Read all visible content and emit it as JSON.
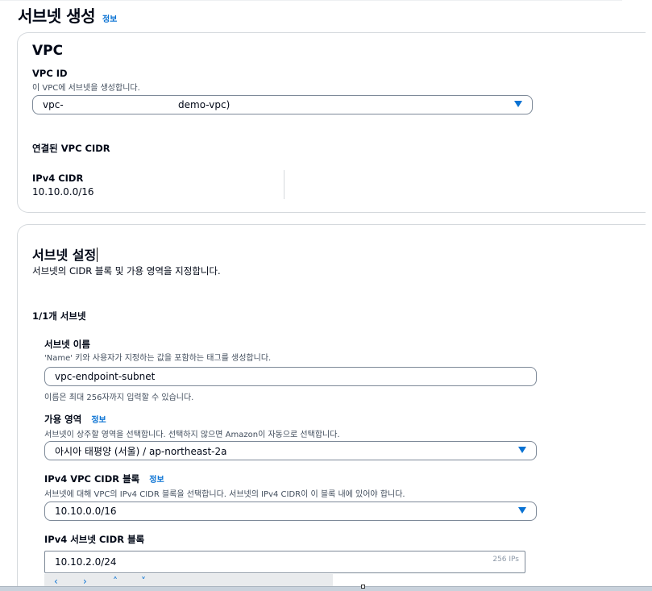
{
  "page": {
    "title": "서브넷 생성",
    "info_label": "정보"
  },
  "vpc_section": {
    "title": "VPC",
    "vpc_id": {
      "label": "VPC ID",
      "description": "이 VPC에 서브넷을 생성합니다.",
      "selected_prefix": "vpc-",
      "selected_suffix": "demo-vpc)"
    },
    "cidr_heading": "연결된 VPC CIDR",
    "ipv4_cidr": {
      "label": "IPv4 CIDR",
      "value": "10.10.0.0/16"
    }
  },
  "subnet_section": {
    "title": "서브넷 설정",
    "description": "서브넷의 CIDR 블록 및 가용 영역을 지정합니다.",
    "count_label": "1/1개 서브넷",
    "name": {
      "label": "서브넷 이름",
      "description": "'Name' 키와 사용자가 지정하는 값을 포함하는 태그를 생성합니다.",
      "value": "vpc-endpoint-subnet",
      "hint": "이름은 최대 256자까지 입력할 수 있습니다."
    },
    "az": {
      "label": "가용 영역",
      "info_label": "정보",
      "description": "서브넷이 상주할 영역을 선택합니다. 선택하지 않으면 Amazon이 자동으로 선택합니다.",
      "value": "아시아 태평양 (서울) / ap-northeast-2a"
    },
    "vpc_cidr": {
      "label": "IPv4 VPC CIDR 블록",
      "info_label": "정보",
      "description": "서브넷에 대해 VPC의 IPv4 CIDR 블록을 선택합니다. 서브넷의 IPv4 CIDR이 이 블록 내에 있어야 합니다.",
      "value": "10.10.0.0/16"
    },
    "subnet_cidr": {
      "label": "IPv4 서브넷 CIDR 블록",
      "value": "10.10.2.0/24",
      "ip_count": "256 IPs"
    },
    "nav_buttons": [
      "‹",
      "›",
      "˄",
      "˅"
    ]
  }
}
